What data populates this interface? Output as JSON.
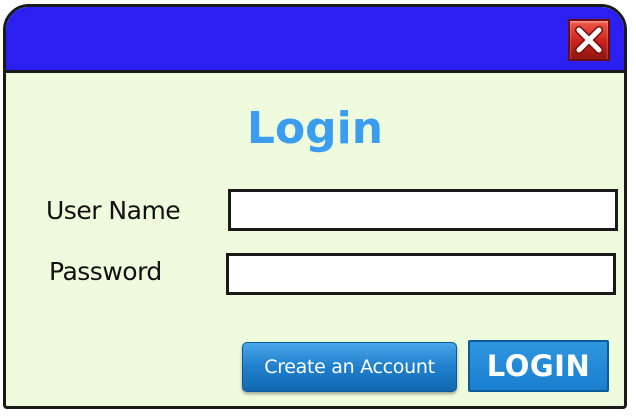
{
  "dialog": {
    "title": "Login",
    "fields": {
      "username": {
        "label": "User Name",
        "value": "",
        "placeholder": ""
      },
      "password": {
        "label": "Password",
        "value": "",
        "placeholder": ""
      }
    },
    "buttons": {
      "create_account": "Create an Account",
      "login": "LOGIN",
      "close_icon": "close-icon"
    }
  },
  "colors": {
    "titlebar": "#2c1ff2",
    "window_background": "#effbdd",
    "title_text": "#3a9df0",
    "button_blue": "#1f7fcc",
    "close_red": "#c9221a"
  }
}
